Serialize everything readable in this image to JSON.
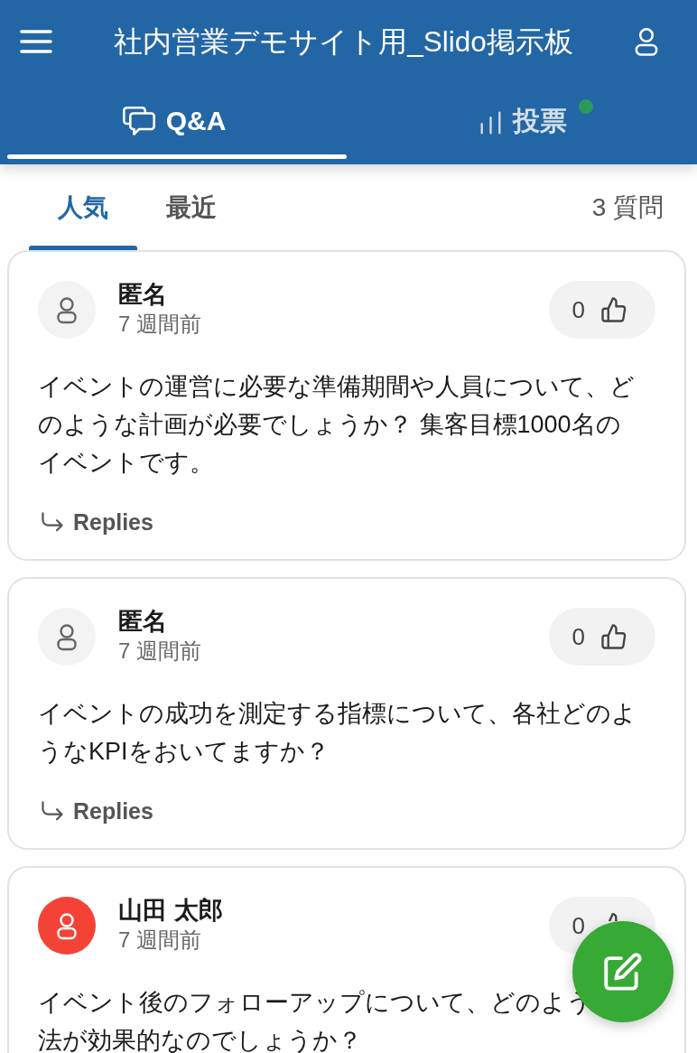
{
  "header": {
    "title": "社内営業デモサイト用_Slido掲示板"
  },
  "tabs": [
    {
      "label": "Q&A",
      "kind": "qa",
      "selected": true,
      "has_new": false
    },
    {
      "label": "投票",
      "kind": "polls",
      "selected": false,
      "has_new": true
    }
  ],
  "sort_tabs": [
    {
      "label": "人気",
      "selected": true
    },
    {
      "label": "最近",
      "selected": false
    }
  ],
  "question_count": "3 質問",
  "questions": [
    {
      "author": "匿名",
      "time": "7 週間前",
      "color": "#f3f3f3",
      "votes": "0",
      "text": "イベントの運営に必要な準備期間や人員について、どのような計画が必要でしょうか？ 集客目標1000名のイベントです。",
      "replies_label": "Replies"
    },
    {
      "author": "匿名",
      "time": "7 週間前",
      "color": "#f3f3f3",
      "votes": "0",
      "text": "イベントの成功を測定する指標について、各社どのようなKPIをおいてますか？",
      "replies_label": "Replies"
    },
    {
      "author": "山田 太郎",
      "time": "7 週間前",
      "color": "#f44336",
      "votes": "0",
      "text_lines": [
        "イベント後のフォローアップについて、どのよう",
        "法が効果的なのでしょうか？"
      ]
    }
  ]
}
